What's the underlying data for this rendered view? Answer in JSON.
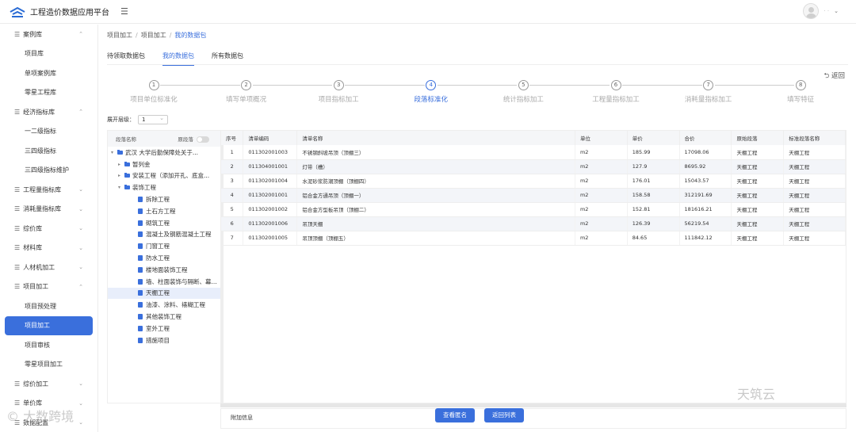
{
  "app": {
    "title": "工程造价数据应用平台",
    "menu_icon": "hamburger-icon"
  },
  "user": {
    "name": "·  ·"
  },
  "sidebar": {
    "items": [
      {
        "type": "group",
        "label": "案例库",
        "chev": "⌃"
      },
      {
        "type": "sub",
        "label": "项目库"
      },
      {
        "type": "sub",
        "label": "单项案例库"
      },
      {
        "type": "sub",
        "label": "零星工程库"
      },
      {
        "type": "group",
        "label": "经济指标库",
        "chev": "⌃"
      },
      {
        "type": "sub",
        "label": "一二级指标"
      },
      {
        "type": "sub",
        "label": "三四级指标"
      },
      {
        "type": "sub",
        "label": "三四级指标维护"
      },
      {
        "type": "group",
        "label": "工程量指标库",
        "chev": "⌄"
      },
      {
        "type": "group",
        "label": "消耗量指标库",
        "chev": "⌄"
      },
      {
        "type": "group",
        "label": "综价库",
        "chev": "⌄"
      },
      {
        "type": "group",
        "label": "材料库",
        "chev": "⌄"
      },
      {
        "type": "group",
        "label": "人材机加工",
        "chev": "⌄"
      },
      {
        "type": "group",
        "label": "项目加工",
        "chev": "⌃"
      },
      {
        "type": "sub",
        "label": "项目预处理"
      },
      {
        "type": "sub",
        "label": "项目加工",
        "active": true
      },
      {
        "type": "sub",
        "label": "项目审核"
      },
      {
        "type": "sub",
        "label": "零星项目加工"
      },
      {
        "type": "group",
        "label": "综价加工",
        "chev": "⌄"
      },
      {
        "type": "group",
        "label": "单价库",
        "chev": "⌄"
      },
      {
        "type": "group",
        "label": "数据配置",
        "chev": "⌄"
      }
    ]
  },
  "breadcrumb": {
    "l1": "项目加工",
    "l2": "项目加工",
    "current": "我的数据包",
    "sep": "/"
  },
  "tabs": [
    {
      "label": "待领取数据包"
    },
    {
      "label": "我的数据包",
      "active": true
    },
    {
      "label": "所有数据包"
    }
  ],
  "back": "⮌ 返回",
  "steps": [
    {
      "n": "1",
      "label": "项目单位标准化"
    },
    {
      "n": "2",
      "label": "填写单项概况"
    },
    {
      "n": "3",
      "label": "项目指标加工"
    },
    {
      "n": "4",
      "label": "段落标准化",
      "active": true
    },
    {
      "n": "5",
      "label": "统计指标加工"
    },
    {
      "n": "6",
      "label": "工程量指标加工"
    },
    {
      "n": "7",
      "label": "消耗量指标加工"
    },
    {
      "n": "8",
      "label": "填写特征"
    }
  ],
  "expand": {
    "label": "展开层级：",
    "value": "1"
  },
  "tree": {
    "col_name": "段落名称",
    "col_orig": "原段落",
    "nodes": [
      {
        "level": 0,
        "arrow": "▾",
        "icon": "folder",
        "label": "武汉      大学后勤保障处关于..."
      },
      {
        "level": 1,
        "arrow": "▸",
        "icon": "folder",
        "label": "暂列金"
      },
      {
        "level": 1,
        "arrow": "▸",
        "icon": "folder",
        "label": "安装工程（添加开孔、底盒..."
      },
      {
        "level": 1,
        "arrow": "▾",
        "icon": "folder",
        "label": "装饰工程"
      },
      {
        "level": 2,
        "icon": "doc",
        "label": "拆除工程"
      },
      {
        "level": 2,
        "icon": "doc",
        "label": "土石方工程"
      },
      {
        "level": 2,
        "icon": "doc",
        "label": "砌筑工程"
      },
      {
        "level": 2,
        "icon": "doc",
        "label": "混凝土及钢筋混凝土工程"
      },
      {
        "level": 2,
        "icon": "doc",
        "label": "门窗工程"
      },
      {
        "level": 2,
        "icon": "doc",
        "label": "防水工程"
      },
      {
        "level": 2,
        "icon": "doc",
        "label": "楼地面装饰工程"
      },
      {
        "level": 2,
        "icon": "doc",
        "label": "墙、柱面装饰与隔断、幕..."
      },
      {
        "level": 2,
        "icon": "doc",
        "label": "天棚工程",
        "selected": true
      },
      {
        "level": 2,
        "icon": "doc",
        "label": "油漆、涂料、裱糊工程"
      },
      {
        "level": 2,
        "icon": "doc",
        "label": "其他装饰工程"
      },
      {
        "level": 2,
        "icon": "doc",
        "label": "室外工程"
      },
      {
        "level": 2,
        "icon": "doc",
        "label": "措施项目"
      }
    ]
  },
  "table": {
    "headers": [
      "序号",
      "清单编码",
      "清单名称",
      "单位",
      "单价",
      "合价",
      "原始段落",
      "标准段落名称"
    ],
    "rows": [
      [
        "1",
        "011302001003",
        "不锈钢斜坡吊顶（顶棚三）",
        "m2",
        "185.99",
        "17098.06",
        "天棚工程",
        "天棚工程"
      ],
      [
        "2",
        "011304001001",
        "灯带（槽）",
        "m2",
        "127.9",
        "8695.92",
        "天棚工程",
        "天棚工程"
      ],
      [
        "3",
        "011302001004",
        "水泥砂浆防潮顶棚（顶棚四）",
        "m2",
        "176.01",
        "15043.57",
        "天棚工程",
        "天棚工程"
      ],
      [
        "4",
        "011302001001",
        "铝合金方通吊顶（顶棚一）",
        "m2",
        "158.58",
        "312191.69",
        "天棚工程",
        "天棚工程"
      ],
      [
        "5",
        "011302001002",
        "铝合金方型板吊顶（顶棚二）",
        "m2",
        "152.81",
        "181616.21",
        "天棚工程",
        "天棚工程"
      ],
      [
        "6",
        "011302001006",
        "吊顶天棚",
        "m2",
        "126.39",
        "56219.54",
        "天棚工程",
        "天棚工程"
      ],
      [
        "7",
        "011302001005",
        "吊顶顶棚（顶棚五）",
        "m2",
        "84.65",
        "111842.12",
        "天棚工程",
        "天棚工程"
      ]
    ]
  },
  "addinfo": "附加信息",
  "buttons": {
    "view": "查看匿名",
    "back_list": "返回列表"
  },
  "watermarks": {
    "left": "© 大数跨境",
    "right": "天筑云"
  }
}
